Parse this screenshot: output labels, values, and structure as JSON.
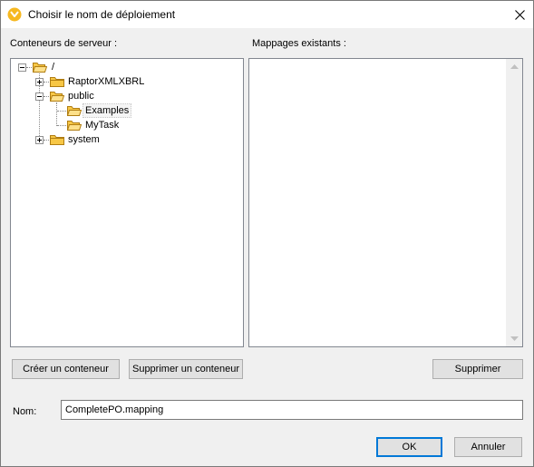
{
  "window": {
    "title": "Choisir le nom de déploiement",
    "app_icon": "altova-mapforce-icon",
    "close_icon": "close-icon"
  },
  "left_panel": {
    "label": "Conteneurs de serveur :",
    "tree": {
      "root": "/",
      "items": [
        {
          "label": "RaptorXMLXBRL",
          "expanded": false
        },
        {
          "label": "public",
          "expanded": true,
          "children": [
            {
              "label": "Examples",
              "selected": true
            },
            {
              "label": "MyTask"
            }
          ]
        },
        {
          "label": "system",
          "expanded": false
        }
      ]
    }
  },
  "right_panel": {
    "label": "Mappages existants :"
  },
  "buttons": {
    "create_container": "Créer un conteneur",
    "delete_container": "Supprimer un conteneur",
    "delete": "Supprimer",
    "ok": "OK",
    "cancel": "Annuler"
  },
  "name_field": {
    "label": "Nom:",
    "value": "CompletePO.mapping"
  },
  "colors": {
    "dialog_bg": "#f0f0f0",
    "folder_fill": "#f7c746",
    "folder_stroke": "#b07d12",
    "default_button_border": "#0078d7",
    "app_icon_fill": "#f6b820"
  }
}
